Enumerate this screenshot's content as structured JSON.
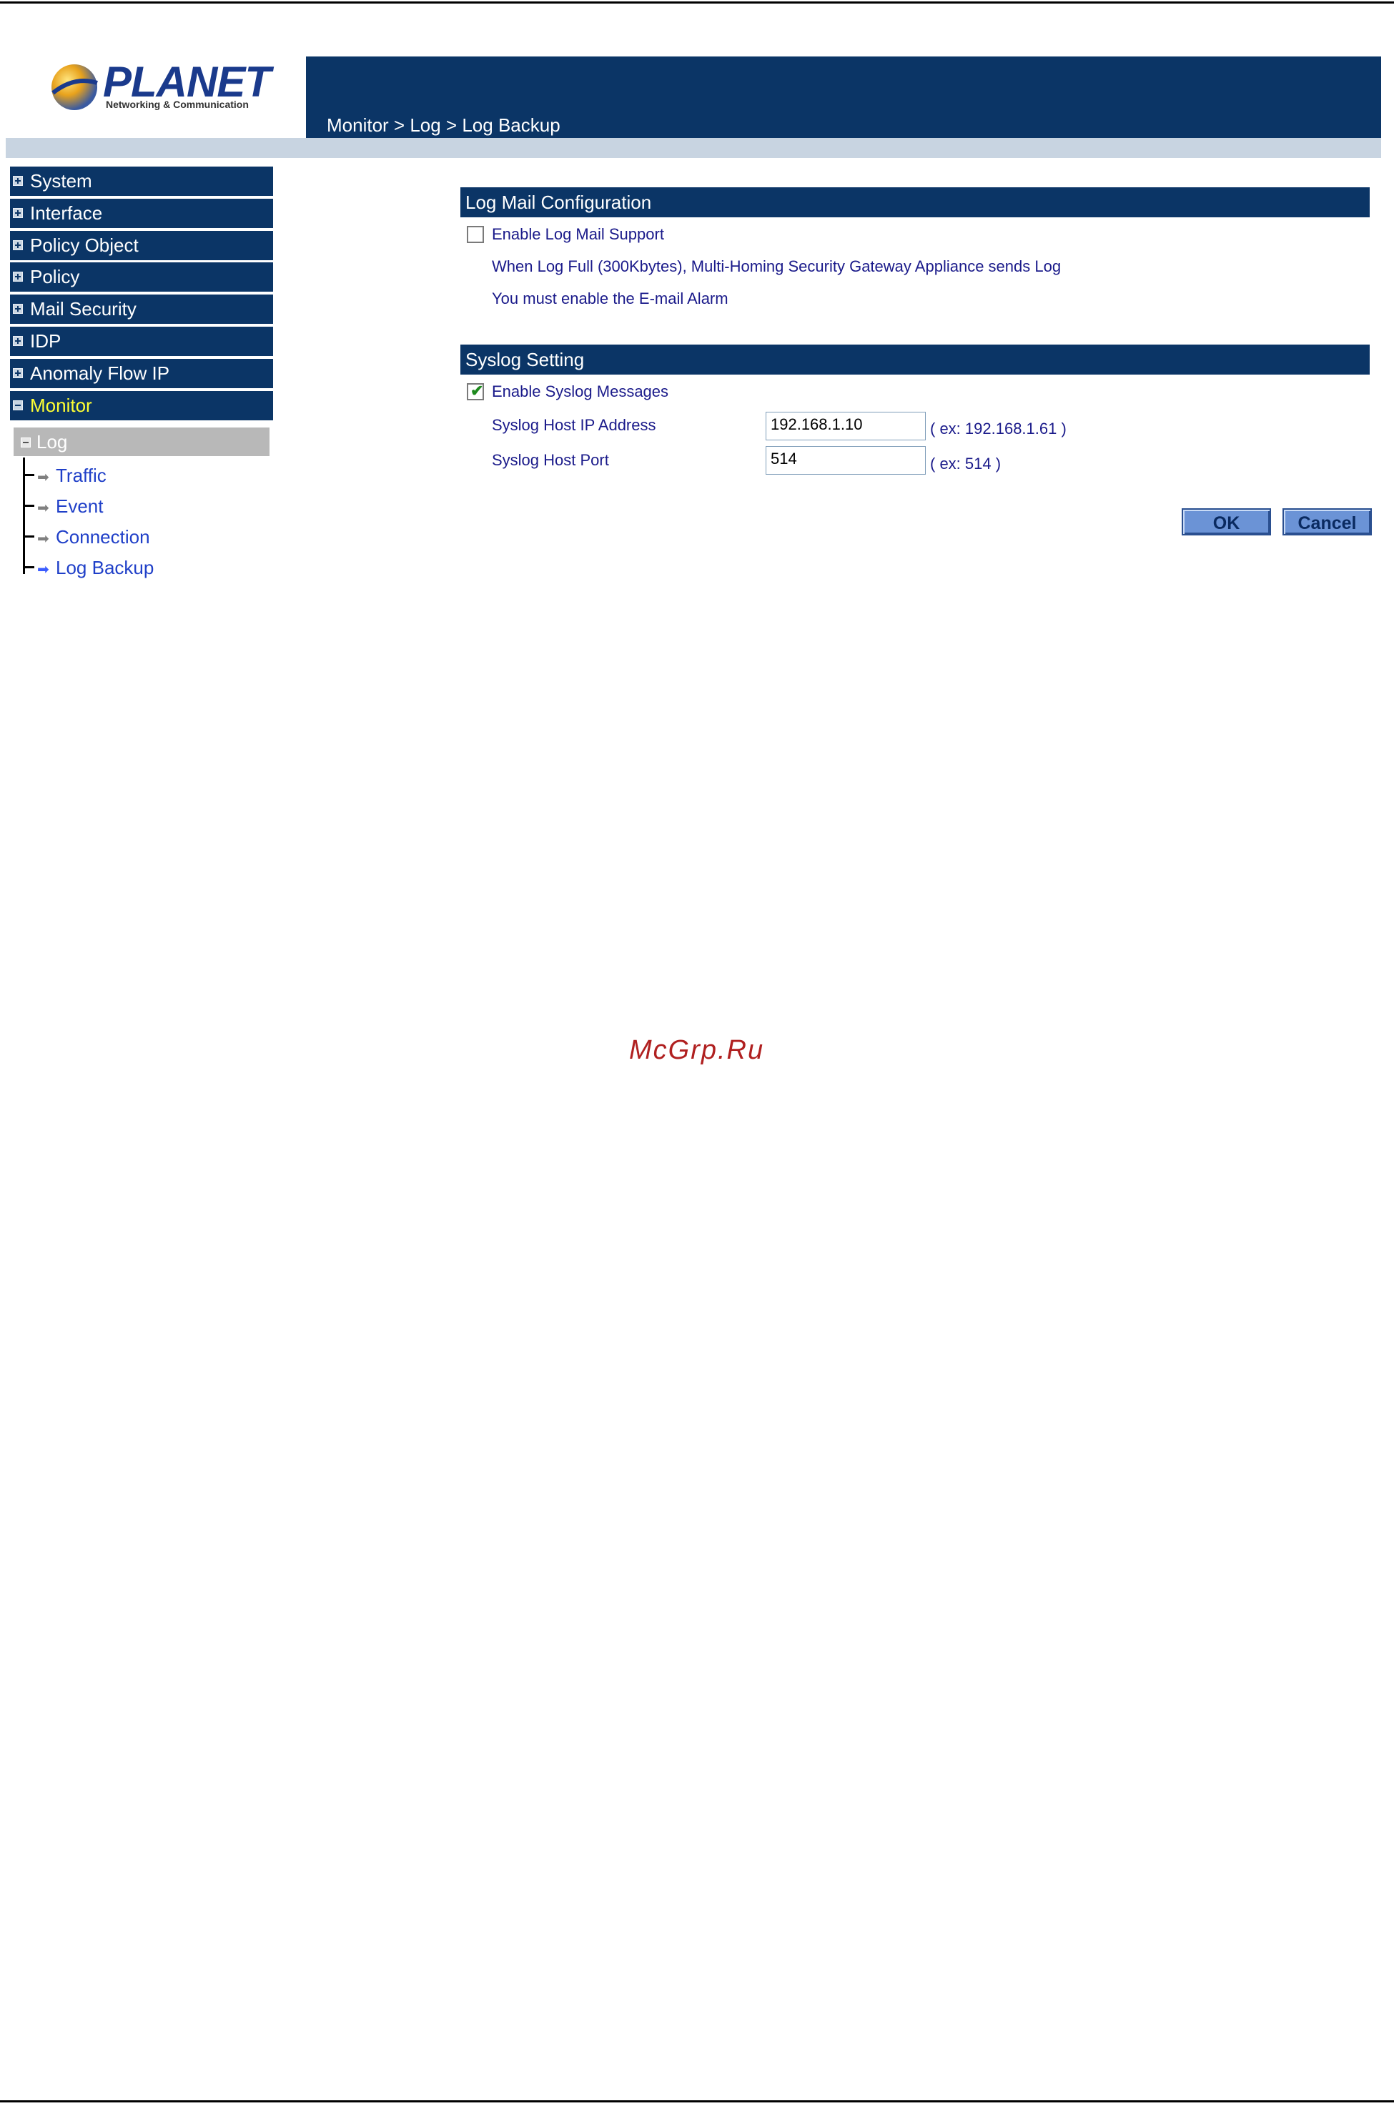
{
  "brand": {
    "name": "PLANET",
    "tagline": "Networking & Communication"
  },
  "header": {
    "breadcrumb": "Monitor > Log > Log Backup"
  },
  "sidebar": {
    "items": [
      {
        "label": "System"
      },
      {
        "label": "Interface"
      },
      {
        "label": "Policy Object"
      },
      {
        "label": "Policy"
      },
      {
        "label": "Mail Security"
      },
      {
        "label": "IDP"
      },
      {
        "label": "Anomaly Flow IP"
      },
      {
        "label": "Monitor"
      }
    ],
    "sub": {
      "label": "Log"
    },
    "tree": [
      {
        "label": "Traffic"
      },
      {
        "label": "Event"
      },
      {
        "label": "Connection"
      },
      {
        "label": "Log Backup"
      }
    ]
  },
  "log_mail": {
    "title": "Log Mail Configuration",
    "checkbox_label": "Enable Log Mail Support",
    "checked": false,
    "note1": "When Log Full (300Kbytes), Multi-Homing Security Gateway Appliance sends Log",
    "note2": "You must enable the E-mail Alarm"
  },
  "syslog": {
    "title": "Syslog Setting",
    "checkbox_label": "Enable Syslog Messages",
    "checked": true,
    "host_ip_label": "Syslog Host IP Address",
    "host_ip_value": "192.168.1.10",
    "host_ip_hint": "( ex: 192.168.1.61 )",
    "host_port_label": "Syslog Host Port",
    "host_port_value": "514",
    "host_port_hint": "( ex: 514 )"
  },
  "buttons": {
    "ok": "OK",
    "cancel": "Cancel"
  },
  "watermark": "McGrp.Ru",
  "colors": {
    "nav_bg": "#0b3566",
    "active_text": "#ffff33",
    "link": "#1f3fc8"
  }
}
